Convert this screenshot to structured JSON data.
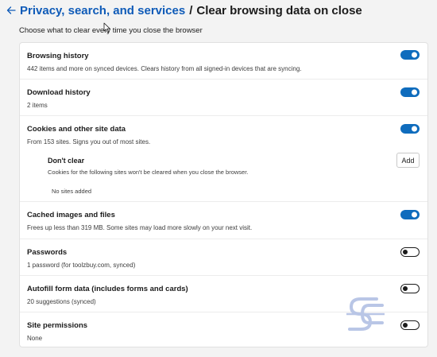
{
  "header": {
    "back_icon": "back-arrow-icon",
    "breadcrumb_parent": "Privacy, search, and services",
    "separator": "/",
    "current": "Clear browsing data on close"
  },
  "subtitle": "Choose what to clear every time you close the browser",
  "colors": {
    "accent": "#0f5bb8",
    "toggle_on": "#0f6cbd",
    "page_bg": "#f3f3f3",
    "panel_bg": "#ffffff"
  },
  "settings": [
    {
      "title": "Browsing history",
      "description": "442 items and more on synced devices. Clears history from all signed-in devices that are syncing.",
      "enabled": true
    },
    {
      "title": "Download history",
      "description": "2 items",
      "enabled": true
    },
    {
      "title": "Cookies and other site data",
      "description": "From 153 sites. Signs you out of most sites.",
      "enabled": true
    },
    {
      "title": "Cached images and files",
      "description": "Frees up less than 319 MB. Some sites may load more slowly on your next visit.",
      "enabled": true
    },
    {
      "title": "Passwords",
      "description": "1 password (for toolzbuy.com, synced)",
      "enabled": false
    },
    {
      "title": "Autofill form data (includes forms and cards)",
      "description": "20 suggestions (synced)",
      "enabled": false
    },
    {
      "title": "Site permissions",
      "description": "None",
      "enabled": false
    }
  ],
  "dont_clear": {
    "title": "Don't clear",
    "description": "Cookies for the following sites won't be cleared when you close the browser.",
    "add_label": "Add",
    "empty_text": "No sites added"
  },
  "watermark": {
    "icon": "sc-logo-watermark",
    "letters": "SC"
  }
}
